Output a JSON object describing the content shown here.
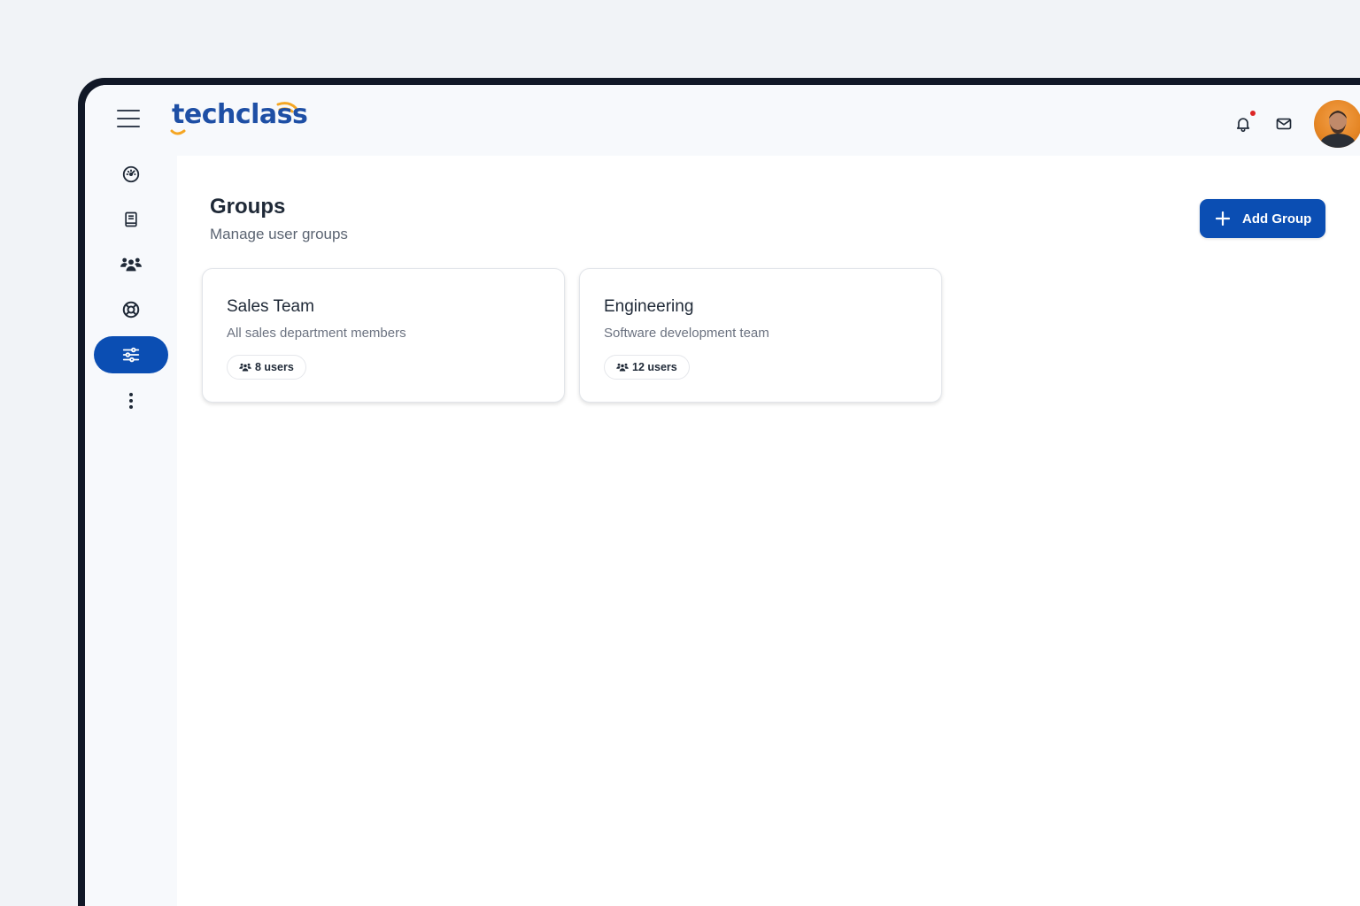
{
  "brand": {
    "name": "techclass",
    "primary": "#0b4eb3",
    "logo_color": "#1e4fa5",
    "accent_orange": "#f5a623"
  },
  "header": {
    "menu_icon": "hamburger-icon",
    "icons": [
      "bell-icon",
      "mail-icon"
    ],
    "has_notification": true
  },
  "sidebar": {
    "items": [
      {
        "icon": "dashboard-gauge-icon",
        "active": false
      },
      {
        "icon": "book-icon",
        "active": false
      },
      {
        "icon": "users-group-icon",
        "active": false
      },
      {
        "icon": "lifebuoy-icon",
        "active": false
      },
      {
        "icon": "sliders-icon",
        "active": true
      },
      {
        "icon": "more-vertical-icon",
        "active": false
      }
    ]
  },
  "page": {
    "title": "Groups",
    "subtitle": "Manage user groups",
    "add_button_label": "Add Group"
  },
  "groups": [
    {
      "name": "Sales Team",
      "description": "All sales department members",
      "users_label": "8 users"
    },
    {
      "name": "Engineering",
      "description": "Software development team",
      "users_label": "12 users"
    }
  ]
}
